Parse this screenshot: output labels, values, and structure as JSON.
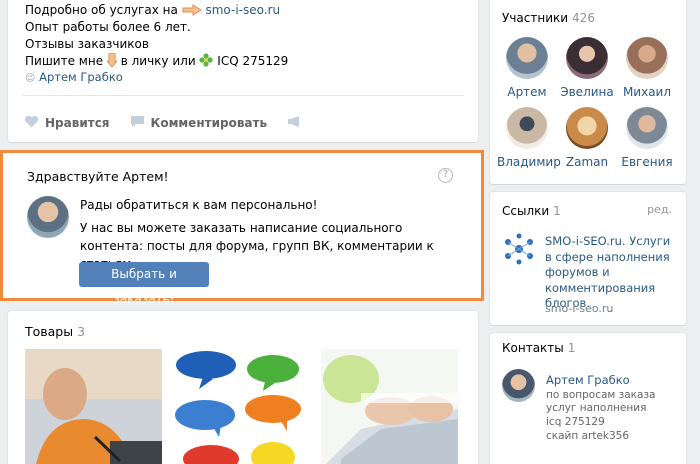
{
  "post": {
    "line1_prefix": "Подробно об услугах на",
    "line1_link": "smo-i-seo.ru",
    "line2": "Опыт работы более 6 лет.",
    "line3": "Отзывы заказчиков",
    "line4_prefix": "Пишите мне",
    "line4_mid": "в личку или",
    "line4_icq": "ICQ 275129",
    "author": "Артем Грабко",
    "like_label": "Нравится",
    "comment_label": "Комментировать"
  },
  "promo": {
    "title": "Здравствуйте Артем!",
    "help": "?",
    "greeting": "Рады обратиться к вам персонально!",
    "body": "У нас вы можете заказать написание социального контента: посты для форума, групп ВК, комментарии к статьям.",
    "button": "Выбрать и заказать!"
  },
  "goods": {
    "title": "Товары",
    "count": "3"
  },
  "members": {
    "title": "Участники",
    "count": "426",
    "items": [
      {
        "name": "Артем",
        "color": "#6b7f95"
      },
      {
        "name": "Эвелина",
        "color": "#3a2d33"
      },
      {
        "name": "Михаил",
        "color": "#9a6f5a"
      },
      {
        "name": "Владимир",
        "color": "#c9b8a3"
      },
      {
        "name": "Zaman",
        "color": "#c98a4a"
      },
      {
        "name": "Евгения",
        "color": "#7d8a95"
      }
    ]
  },
  "links": {
    "title": "Ссылки",
    "count": "1",
    "edit": "ред.",
    "item_title": "SMO-i-SEO.ru. Услуги в сфере наполнения форумов и комментирования блогов.",
    "item_url": "smo-i-seo.ru"
  },
  "contacts": {
    "title": "Контакты",
    "count": "1",
    "name": "Артем Грабко",
    "role": "по вопросам заказа услуг наполнения",
    "icq": "icq 275129",
    "skype": "скайп artek356"
  }
}
